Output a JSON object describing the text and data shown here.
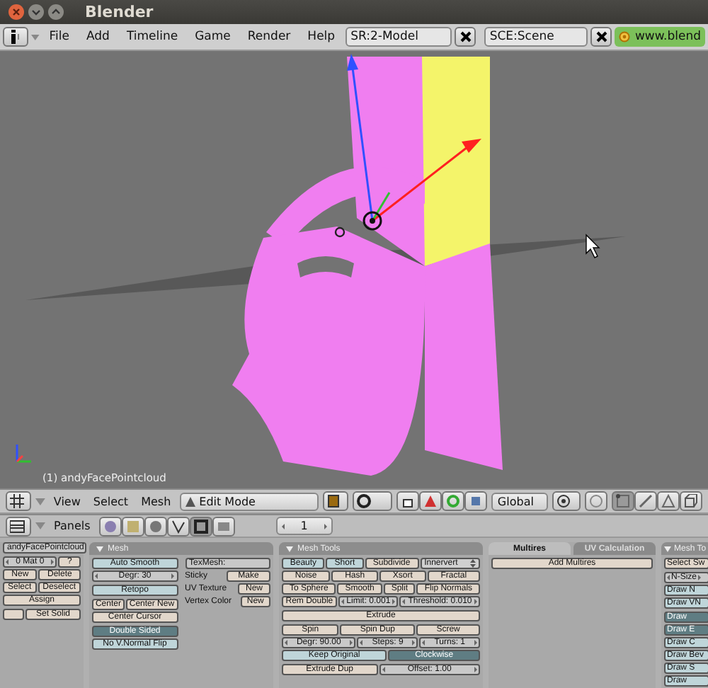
{
  "window": {
    "title": "Blender"
  },
  "menu_bar": {
    "menus": [
      "File",
      "Add",
      "Timeline",
      "Game",
      "Render",
      "Help"
    ],
    "screen": "SR:2-Model",
    "scene": "SCE:Scene",
    "link": "www.blend"
  },
  "viewport": {
    "object_label": "(1) andyFacePointcloud"
  },
  "view3d_header": {
    "menus": [
      "View",
      "Select",
      "Mesh"
    ],
    "mode": "Edit Mode",
    "orientation": "Global",
    "select_modes": [
      {
        "selected": true
      },
      {
        "selected": false
      },
      {
        "selected": false
      }
    ]
  },
  "buttons_header": {
    "menu": "Panels",
    "frame": "1"
  },
  "panels": [
    {
      "columns": [
        [
          [
            [
              {
                "kind": "field",
                "label": "andyFacePointcloud"
              }
            ]
          ],
          [
            [
              {
                "kind": "number",
                "label": "0 Mat 0"
              },
              {
                "kind": "button",
                "label": "?"
              }
            ],
            [
              {
                "kind": "button",
                "label": "New"
              },
              {
                "kind": "button",
                "label": "Delete"
              }
            ],
            [
              {
                "kind": "button",
                "label": "Select"
              },
              {
                "kind": "button",
                "label": "Deselect"
              }
            ],
            [
              {
                "kind": "button",
                "label": "Assign"
              }
            ]
          ],
          [
            [
              {
                "kind": "button"
              },
              {
                "kind": "button",
                "label": "Set Solid"
              }
            ]
          ]
        ]
      ]
    },
    {
      "title": "Mesh",
      "columns": [
        [
          [
            [
              {
                "kind": "toggle",
                "label": "Auto Smooth",
                "selected": false
              }
            ],
            [
              {
                "kind": "number",
                "label": "Degr: 30"
              }
            ]
          ],
          [
            [
              {
                "kind": "toggle",
                "label": "Retopo",
                "selected": false
              }
            ]
          ],
          [
            [
              {
                "kind": "button",
                "label": "Center"
              },
              {
                "kind": "button",
                "label": "Center New"
              }
            ],
            [
              {
                "kind": "button",
                "label": "Center Cursor"
              }
            ]
          ],
          [
            [
              {
                "kind": "toggle",
                "label": "Double Sided",
                "selected": true
              }
            ],
            [
              {
                "kind": "toggle",
                "label": "No V.Normal Flip",
                "selected": false
              }
            ]
          ]
        ],
        [
          [
            [
              {
                "kind": "field",
                "label": "TexMesh:"
              }
            ],
            [
              {
                "kind": "label",
                "label": "Sticky"
              },
              {
                "kind": "button",
                "label": "Make"
              }
            ],
            [
              {
                "kind": "label",
                "label": "UV Texture"
              },
              {
                "kind": "button",
                "label": "New"
              }
            ],
            [
              {
                "kind": "label",
                "label": "Vertex Color"
              },
              {
                "kind": "button",
                "label": "New"
              }
            ]
          ]
        ]
      ]
    },
    {
      "title": "Mesh Tools",
      "columns": [
        [
          [
            [
              {
                "kind": "toggle",
                "label": "Beauty",
                "selected": false
              },
              {
                "kind": "toggle",
                "label": "Short",
                "selected": false
              },
              {
                "kind": "button",
                "label": "Subdivide"
              },
              {
                "kind": "menu",
                "label": "Innervert"
              }
            ],
            [
              {
                "kind": "button",
                "label": "Noise"
              },
              {
                "kind": "button",
                "label": "Hash"
              },
              {
                "kind": "button",
                "label": "Xsort"
              },
              {
                "kind": "button",
                "label": "Fractal"
              }
            ],
            [
              {
                "kind": "button",
                "label": "To Sphere"
              },
              {
                "kind": "button",
                "label": "Smooth"
              },
              {
                "kind": "button",
                "label": "Split"
              },
              {
                "kind": "button",
                "label": "Flip Normals"
              }
            ],
            [
              {
                "kind": "button",
                "label": "Rem Double"
              },
              {
                "kind": "number",
                "label": "Limit: 0.001"
              },
              {
                "kind": "number",
                "label": "Threshold: 0.010"
              }
            ]
          ],
          [
            [
              {
                "kind": "button",
                "label": "Extrude"
              }
            ]
          ],
          [
            [
              {
                "kind": "button",
                "label": "Spin"
              },
              {
                "kind": "button",
                "label": "Spin Dup"
              },
              {
                "kind": "button",
                "label": "Screw"
              }
            ],
            [
              {
                "kind": "number",
                "label": "Degr: 90.00"
              },
              {
                "kind": "number",
                "label": "Steps: 9"
              },
              {
                "kind": "number",
                "label": "Turns: 1"
              }
            ],
            [
              {
                "kind": "toggle",
                "label": "Keep Original",
                "selected": false
              },
              {
                "kind": "toggle",
                "label": "Clockwise",
                "selected": true
              }
            ]
          ],
          [
            [
              {
                "kind": "button",
                "label": "Extrude Dup"
              },
              {
                "kind": "number",
                "label": "Offset: 1.00"
              }
            ]
          ]
        ]
      ]
    },
    {
      "tabs": [
        {
          "label": "Multires",
          "selected": true
        },
        {
          "label": "UV Calculation",
          "selected": false
        }
      ],
      "columns": [
        [
          [
            [
              {
                "kind": "button",
                "label": "Add Multires"
              }
            ]
          ]
        ]
      ]
    },
    {
      "title": "Mesh To",
      "columns": [
        [
          [
            [
              {
                "kind": "button",
                "label": "Select Sw"
              }
            ]
          ],
          [
            [
              {
                "kind": "number",
                "label": "N-Size"
              }
            ],
            [
              {
                "kind": "toggle",
                "label": "Draw N",
                "selected": false
              }
            ],
            [
              {
                "kind": "toggle",
                "label": "Draw VN",
                "selected": false
              }
            ]
          ],
          [
            [
              {
                "kind": "toggle",
                "label": "Draw",
                "selected": true
              }
            ],
            [
              {
                "kind": "toggle",
                "label": "Draw E",
                "selected": true
              }
            ],
            [
              {
                "kind": "toggle",
                "label": "Draw C",
                "selected": false
              }
            ],
            [
              {
                "kind": "toggle",
                "label": "Draw Bev",
                "selected": false
              }
            ],
            [
              {
                "kind": "toggle",
                "label": "Draw S",
                "selected": false
              }
            ],
            [
              {
                "kind": "toggle",
                "label": "Draw",
                "selected": false
              }
            ]
          ]
        ]
      ]
    }
  ]
}
